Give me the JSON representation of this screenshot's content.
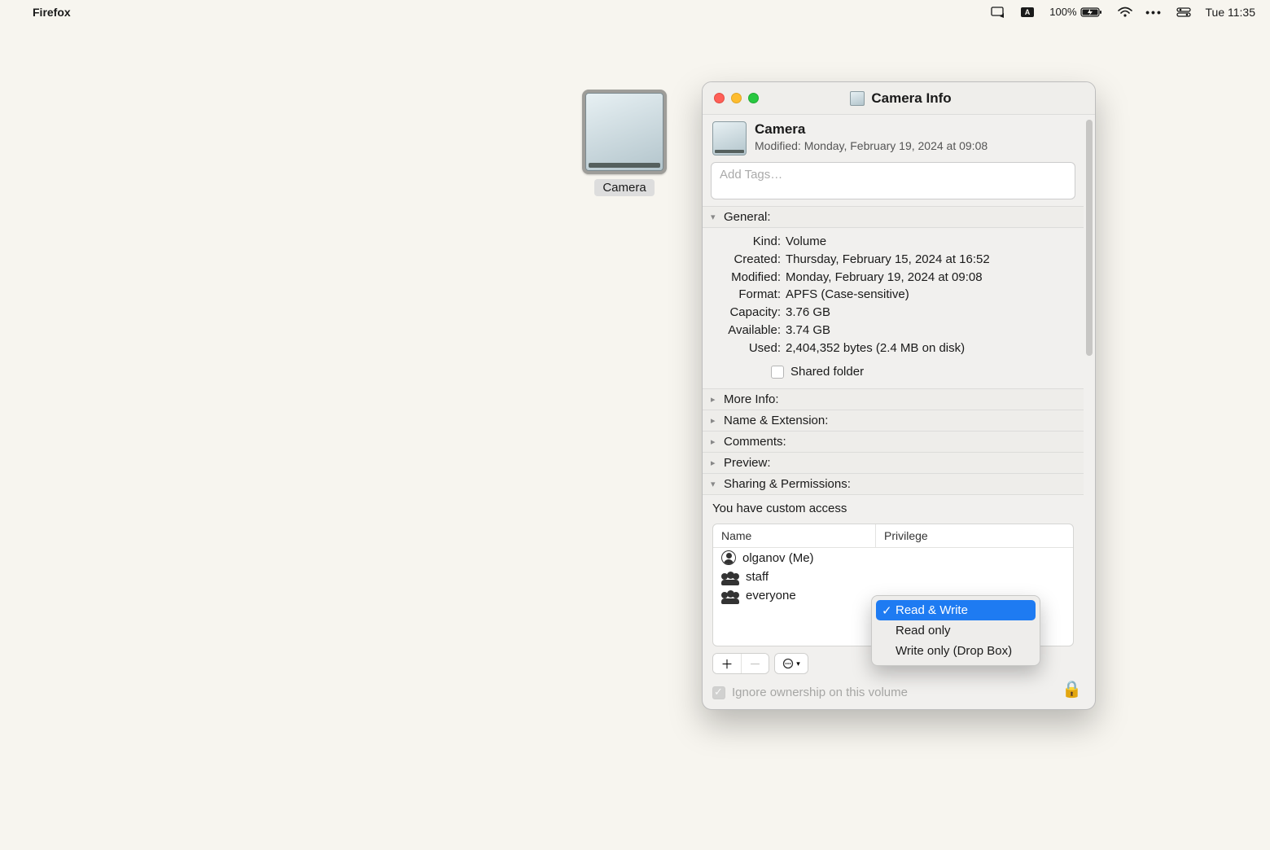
{
  "menubar": {
    "app_name": "Firefox",
    "battery": "100%",
    "time": "Tue 11:35"
  },
  "desktop": {
    "drive_label": "Camera"
  },
  "info": {
    "title": "Camera Info",
    "name": "Camera",
    "modified_label": "Modified:",
    "modified_value": "Monday, February 19, 2024 at 09:08",
    "tags_placeholder": "Add Tags…",
    "sections": {
      "general": "General:",
      "more_info": "More Info:",
      "name_ext": "Name & Extension:",
      "comments": "Comments:",
      "preview": "Preview:",
      "sharing": "Sharing & Permissions:"
    },
    "general": {
      "kind_k": "Kind:",
      "kind_v": "Volume",
      "created_k": "Created:",
      "created_v": "Thursday, February 15, 2024 at 16:52",
      "modified_k": "Modified:",
      "modified_v": "Monday, February 19, 2024 at 09:08",
      "format_k": "Format:",
      "format_v": "APFS (Case-sensitive)",
      "capacity_k": "Capacity:",
      "capacity_v": "3.76 GB",
      "available_k": "Available:",
      "available_v": "3.74 GB",
      "used_k": "Used:",
      "used_v": "2,404,352 bytes (2.4 MB on disk)",
      "shared_folder": "Shared folder"
    },
    "sharing": {
      "custom_access": "You have custom access",
      "col_name": "Name",
      "col_priv": "Privilege",
      "rows": [
        {
          "name": "olganov (Me)"
        },
        {
          "name": "staff"
        },
        {
          "name": "everyone"
        }
      ],
      "ignore_label": "Ignore ownership on this volume"
    },
    "priv_menu": {
      "read_write": "Read & Write",
      "read_only": "Read only",
      "write_only": "Write only (Drop Box)"
    }
  }
}
